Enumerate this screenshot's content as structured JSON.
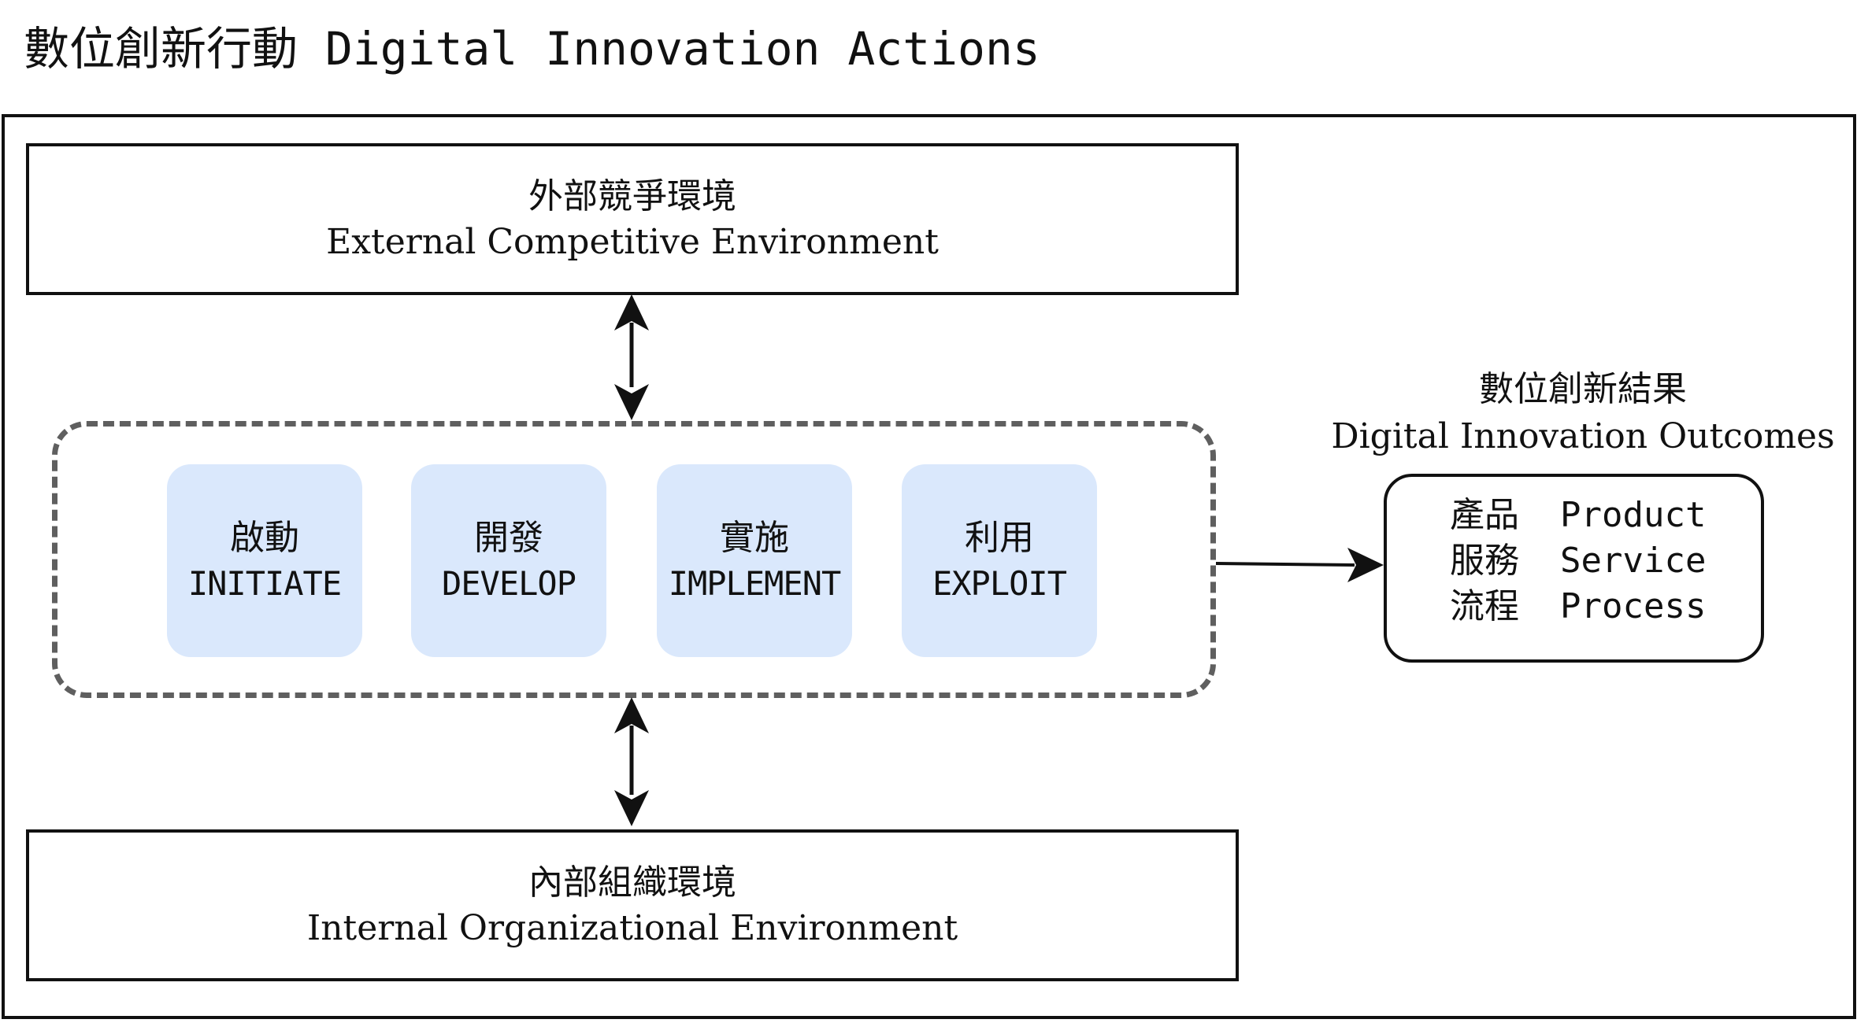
{
  "title": "數位創新行動 Digital Innovation Actions",
  "external_environment": {
    "zh": "外部競爭環境",
    "en": "External Competitive Environment"
  },
  "internal_environment": {
    "zh": "內部組織環境",
    "en": "Internal Organizational Environment"
  },
  "stages": [
    {
      "zh": "啟動",
      "en": "INITIATE"
    },
    {
      "zh": "開發",
      "en": "DEVELOP"
    },
    {
      "zh": "實施",
      "en": "IMPLEMENT"
    },
    {
      "zh": "利用",
      "en": "EXPLOIT"
    }
  ],
  "outcomes": {
    "heading_zh": "數位創新結果",
    "heading_en": "Digital Innovation Outcomes",
    "items": [
      {
        "zh": "產品",
        "en": "Product"
      },
      {
        "zh": "服務",
        "en": "Service"
      },
      {
        "zh": "流程",
        "en": "Process"
      }
    ]
  },
  "colors": {
    "stage_fill": "#dae8fc",
    "dashed_border": "#5f5f5f",
    "line": "#111111"
  }
}
